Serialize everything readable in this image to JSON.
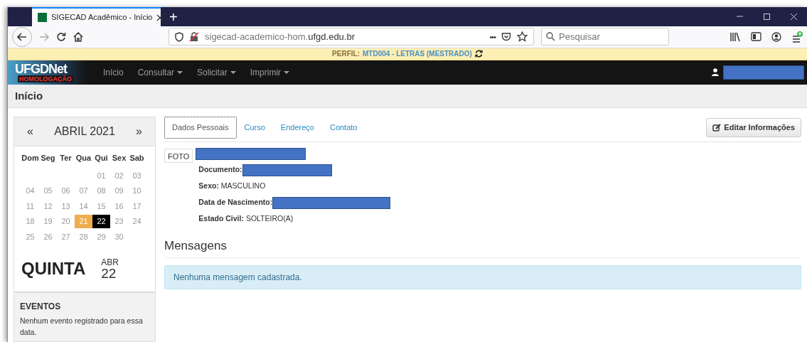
{
  "browser": {
    "tab_title": "SIGECAD Acadêmico - Início",
    "new_tab": "+",
    "url_prefix": "sigecad-academico-hom.",
    "url_domain": "ufgd.edu.br",
    "more": "•••",
    "search_placeholder": "Pesquisar"
  },
  "profile": {
    "label": "PERFIL:",
    "value": "MTD004 - LETRAS (MESTRADO)"
  },
  "navbar": {
    "logo": "UFGDNet",
    "logo_badge": "HOMOLOGAÇÃO",
    "items": [
      {
        "label": "Início",
        "dropdown": false
      },
      {
        "label": "Consultar",
        "dropdown": true
      },
      {
        "label": "Solicitar",
        "dropdown": true
      },
      {
        "label": "Imprimir",
        "dropdown": true
      }
    ]
  },
  "page_title": "Início",
  "calendar": {
    "prev": "«",
    "month": "ABRIL 2021",
    "next": "»",
    "weekdays": [
      "Dom",
      "Seg",
      "Ter",
      "Qua",
      "Qui",
      "Sex",
      "Sab"
    ],
    "weeks": [
      [
        {
          "day": "01",
          "highlighted": false,
          "selected": false
        },
        {
          "day": "02",
          "highlighted": false,
          "selected": false
        },
        {
          "day": "03",
          "highlighted": false,
          "selected": false
        }
      ],
      [
        {
          "day": "04",
          "highlighted": false,
          "selected": false
        },
        {
          "day": "05",
          "highlighted": false,
          "selected": false
        },
        {
          "day": "06",
          "highlighted": false,
          "selected": false
        },
        {
          "day": "07",
          "highlighted": false,
          "selected": false
        },
        {
          "day": "08",
          "highlighted": false,
          "selected": false
        },
        {
          "day": "09",
          "highlighted": false,
          "selected": false
        },
        {
          "day": "10",
          "highlighted": false,
          "selected": false
        }
      ],
      [
        {
          "day": "11",
          "highlighted": false,
          "selected": false
        },
        {
          "day": "12",
          "highlighted": false,
          "selected": false
        },
        {
          "day": "13",
          "highlighted": false,
          "selected": false
        },
        {
          "day": "14",
          "highlighted": false,
          "selected": false
        },
        {
          "day": "15",
          "highlighted": false,
          "selected": false
        },
        {
          "day": "16",
          "highlighted": false,
          "selected": false
        },
        {
          "day": "17",
          "highlighted": false,
          "selected": false
        }
      ],
      [
        {
          "day": "18",
          "highlighted": false,
          "selected": false
        },
        {
          "day": "19",
          "highlighted": false,
          "selected": false
        },
        {
          "day": "20",
          "highlighted": false,
          "selected": false
        },
        {
          "day": "21",
          "highlighted": true,
          "selected": false
        },
        {
          "day": "22",
          "highlighted": false,
          "selected": true
        },
        {
          "day": "23",
          "highlighted": false,
          "selected": false
        },
        {
          "day": "24",
          "highlighted": false,
          "selected": false
        }
      ],
      [
        {
          "day": "25",
          "highlighted": false,
          "selected": false
        },
        {
          "day": "26",
          "highlighted": false,
          "selected": false
        },
        {
          "day": "27",
          "highlighted": false,
          "selected": false
        },
        {
          "day": "28",
          "highlighted": false,
          "selected": false
        },
        {
          "day": "29",
          "highlighted": false,
          "selected": false
        },
        {
          "day": "30",
          "highlighted": false,
          "selected": false
        }
      ]
    ],
    "weekday_name": "QUINTA",
    "month_short": "ABR",
    "date": "22"
  },
  "events": {
    "title": "EVENTOS",
    "text": "Nenhum evento registrado para essa data."
  },
  "tabs": [
    {
      "label": "Dados Pessoais",
      "selected": true
    },
    {
      "label": "Curso",
      "selected": false
    },
    {
      "label": "Endereço",
      "selected": false
    },
    {
      "label": "Contato",
      "selected": false
    }
  ],
  "edit_button": "Editar Informações",
  "photo_label": "FOTO",
  "fields": [
    {
      "kind": "redacted"
    },
    {
      "kind": "redacted",
      "label": "Documento:"
    },
    {
      "kind": "text",
      "label": "Sexo:",
      "value": "MASCULINO"
    },
    {
      "kind": "redacted",
      "label": "Data de Nascimento:"
    },
    {
      "kind": "text",
      "label": "Estado Civil:",
      "value": "SOLTEIRO(A)"
    }
  ],
  "messages": {
    "title": "Mensagens",
    "empty": "Nenhuma mensagem cadastrada."
  }
}
